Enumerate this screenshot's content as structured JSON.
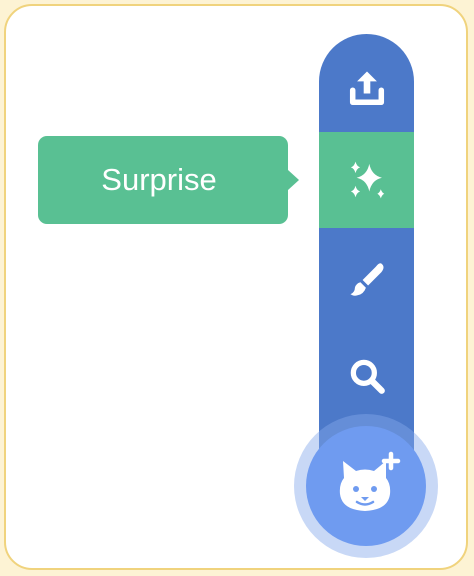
{
  "tooltip": {
    "label": "Surprise"
  },
  "sprite_menu": {
    "items": [
      {
        "name": "upload",
        "icon": "upload-icon"
      },
      {
        "name": "surprise",
        "icon": "sparkles-icon",
        "active": true
      },
      {
        "name": "paint",
        "icon": "paintbrush-icon"
      },
      {
        "name": "search",
        "icon": "search-icon"
      }
    ],
    "main_button_icon": "cat-add-icon"
  },
  "colors": {
    "rail_blue": "#4c79c9",
    "active_green": "#59c093",
    "fab_blue": "#6f9bf0",
    "frame_border": "#f0d37d"
  }
}
